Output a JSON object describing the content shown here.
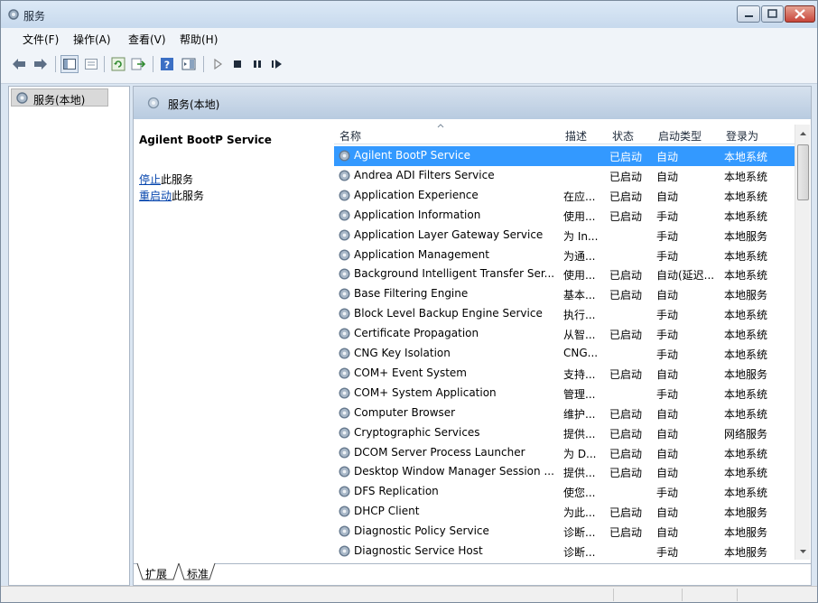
{
  "window": {
    "title": "服务"
  },
  "menu": [
    "文件(F)",
    "操作(A)",
    "查看(V)",
    "帮助(H)"
  ],
  "tree": {
    "root_label": "服务(本地)"
  },
  "pane": {
    "header_label": "服务(本地)"
  },
  "details": {
    "selected_service": "Agilent BootP Service",
    "stop_link": "停止",
    "stop_suffix": "此服务",
    "restart_link": "重启动",
    "restart_suffix": "此服务"
  },
  "table": {
    "columns": [
      "名称",
      "描述",
      "状态",
      "启动类型",
      "登录为"
    ],
    "rows": [
      {
        "name": "Agilent BootP Service",
        "desc": "",
        "status": "已启动",
        "start": "自动",
        "logon": "本地系统",
        "selected": true
      },
      {
        "name": "Andrea ADI Filters Service",
        "desc": "",
        "status": "已启动",
        "start": "自动",
        "logon": "本地系统"
      },
      {
        "name": "Application Experience",
        "desc": "在应...",
        "status": "已启动",
        "start": "自动",
        "logon": "本地系统"
      },
      {
        "name": "Application Information",
        "desc": "使用...",
        "status": "已启动",
        "start": "手动",
        "logon": "本地系统"
      },
      {
        "name": "Application Layer Gateway Service",
        "desc": "为 In...",
        "status": "",
        "start": "手动",
        "logon": "本地服务"
      },
      {
        "name": "Application Management",
        "desc": "为通...",
        "status": "",
        "start": "手动",
        "logon": "本地系统"
      },
      {
        "name": "Background Intelligent Transfer Ser...",
        "desc": "使用...",
        "status": "已启动",
        "start": "自动(延迟...",
        "logon": "本地系统"
      },
      {
        "name": "Base Filtering Engine",
        "desc": "基本...",
        "status": "已启动",
        "start": "自动",
        "logon": "本地服务"
      },
      {
        "name": "Block Level Backup Engine Service",
        "desc": "执行...",
        "status": "",
        "start": "手动",
        "logon": "本地系统"
      },
      {
        "name": "Certificate Propagation",
        "desc": "从智...",
        "status": "已启动",
        "start": "手动",
        "logon": "本地系统"
      },
      {
        "name": "CNG Key Isolation",
        "desc": "CNG...",
        "status": "",
        "start": "手动",
        "logon": "本地系统"
      },
      {
        "name": "COM+ Event System",
        "desc": "支持...",
        "status": "已启动",
        "start": "自动",
        "logon": "本地服务"
      },
      {
        "name": "COM+ System Application",
        "desc": "管理...",
        "status": "",
        "start": "手动",
        "logon": "本地系统"
      },
      {
        "name": "Computer Browser",
        "desc": "维护...",
        "status": "已启动",
        "start": "自动",
        "logon": "本地系统"
      },
      {
        "name": "Cryptographic Services",
        "desc": "提供...",
        "status": "已启动",
        "start": "自动",
        "logon": "网络服务"
      },
      {
        "name": "DCOM Server Process Launcher",
        "desc": "为 D...",
        "status": "已启动",
        "start": "自动",
        "logon": "本地系统"
      },
      {
        "name": "Desktop Window Manager Session ...",
        "desc": "提供...",
        "status": "已启动",
        "start": "自动",
        "logon": "本地系统"
      },
      {
        "name": "DFS Replication",
        "desc": "使您...",
        "status": "",
        "start": "手动",
        "logon": "本地系统"
      },
      {
        "name": "DHCP Client",
        "desc": "为此...",
        "status": "已启动",
        "start": "自动",
        "logon": "本地服务"
      },
      {
        "name": "Diagnostic Policy Service",
        "desc": "诊断...",
        "status": "已启动",
        "start": "自动",
        "logon": "本地服务"
      },
      {
        "name": "Diagnostic Service Host",
        "desc": "诊断...",
        "status": "",
        "start": "手动",
        "logon": "本地服务"
      }
    ]
  },
  "tabs": [
    "扩展",
    "标准"
  ],
  "colors": {
    "selection": "#3399ff",
    "link": "#0645ad",
    "header_gradient_top": "#d6e1ee"
  }
}
